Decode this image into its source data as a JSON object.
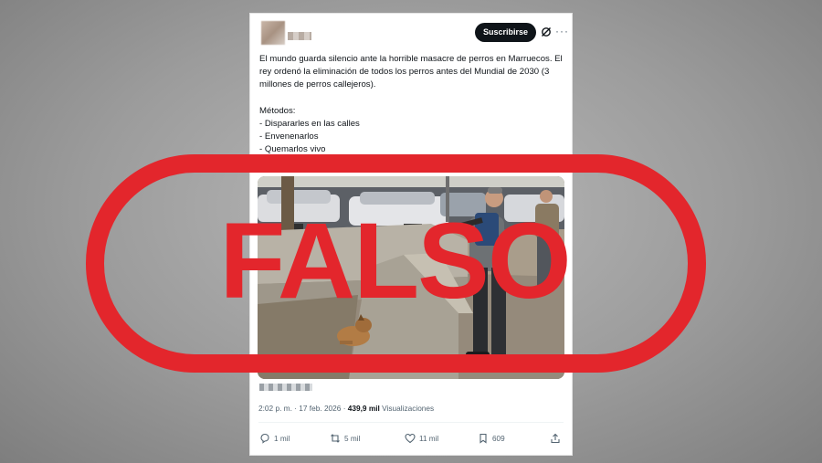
{
  "tweet": {
    "subscribe_label": "Suscribirse",
    "more_icon": "···",
    "text": "El mundo guarda silencio ante la horrible masacre de perros en Marruecos. El rey ordenó la eliminación de todos los perros antes del Mundial de 2030 (3 millones de perros callejeros).\n\nMétodos:\n- Dispararles en las calles\n- Envenenarlos\n- Quemarlos vivo\n- Ahogarlos en jaulas",
    "time": "2:02 p. m. · 17 feb. 2026 · ",
    "views_count": "439,9 mil",
    "views_label": " Visualizaciones",
    "replies": "1 mil",
    "reposts": "5 mil",
    "likes": "11 mil",
    "bookmarks": "609"
  },
  "stamp": {
    "label": "FALSO",
    "color": "#e3262c"
  },
  "icons": [
    "grok-icon",
    "reply-icon",
    "repost-icon",
    "like-icon",
    "bookmark-icon",
    "share-icon"
  ]
}
